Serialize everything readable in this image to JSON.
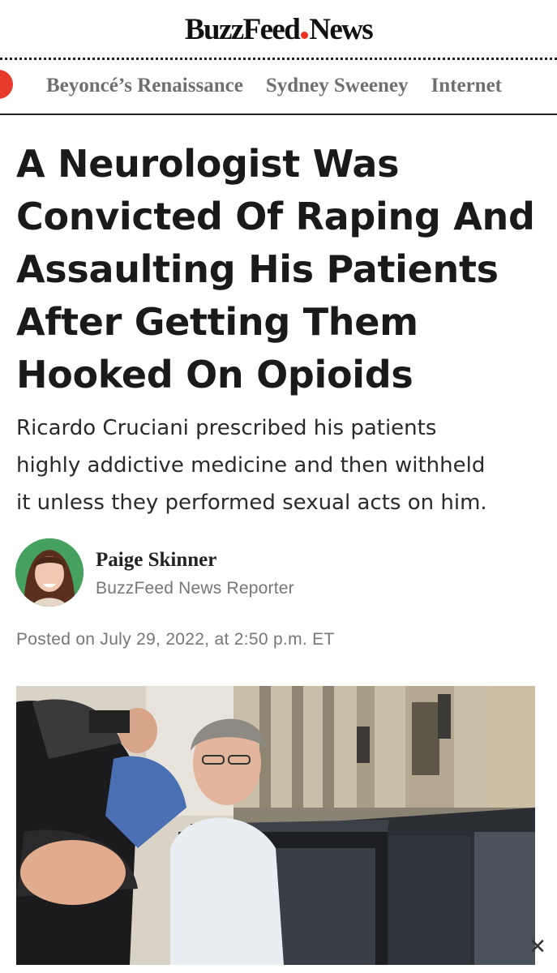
{
  "header": {
    "logo_part1": "BuzzFeed",
    "logo_part2": "News"
  },
  "nav": {
    "items": [
      {
        "label": "Beyoncé’s Renaissance"
      },
      {
        "label": "Sydney Sweeney"
      },
      {
        "label": "Internet"
      }
    ]
  },
  "article": {
    "headline_lines": [
      "A Neurologist Was",
      "Convicted Of Raping And",
      "Assaulting His Patients",
      "After Getting Them",
      "Hooked On Opioids"
    ],
    "dek_lines": [
      "Ricardo Cruciani prescribed his patients",
      "highly addictive medicine and then withheld",
      "it unless they performed sexual acts on him."
    ],
    "author": {
      "name": "Paige Skinner",
      "role": "BuzzFeed News Reporter"
    },
    "posted": "Posted on July 29, 2022, at 2:50 p.m. ET"
  },
  "colors": {
    "accent_red": "#e63a2c",
    "nav_text": "#6f6f6f",
    "meta_text": "#777777"
  },
  "icons": [
    "trending-dot-icon",
    "close-icon"
  ],
  "close_glyph": "✕"
}
